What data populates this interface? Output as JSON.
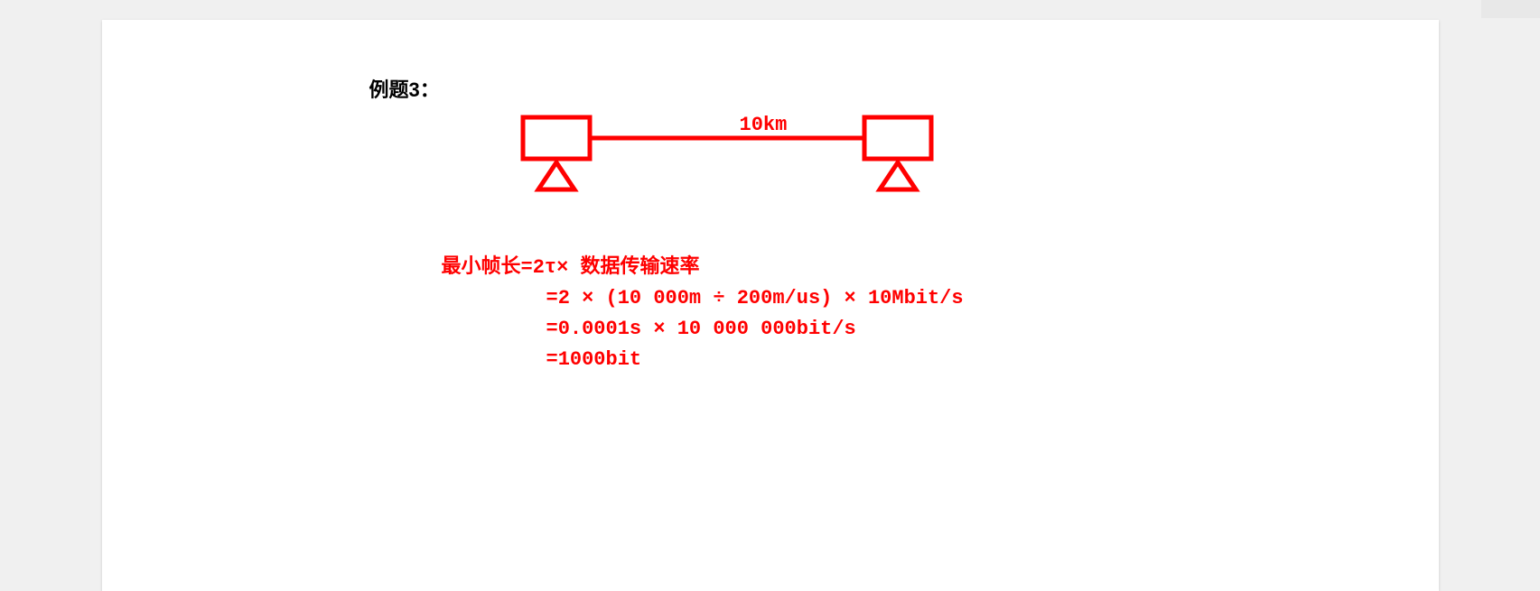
{
  "title": "例题3：",
  "diagram": {
    "distance": "10km",
    "color": "#ff0000"
  },
  "formula": {
    "line1": "最小帧长=2τ× 数据传输速率",
    "line2": "=2 × (10 000m ÷ 200m/us) × 10Mbit/s",
    "line3": "=0.0001s × 10 000 000bit/s",
    "line4": "=1000bit"
  }
}
